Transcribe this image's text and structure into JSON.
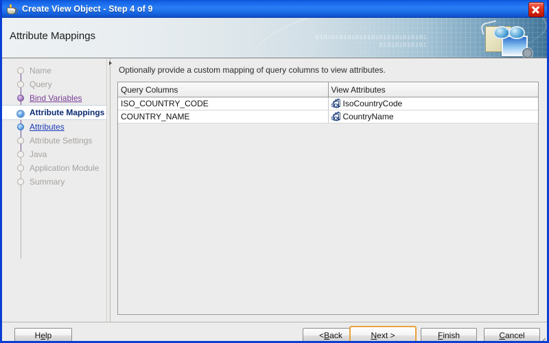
{
  "window": {
    "title": "Create View Object - Step 4 of 9",
    "app_icon": "java-coffee-cup-icon",
    "close_label": "✕",
    "accent_color": "#1565e8",
    "border_color": "#0a3fd4"
  },
  "header": {
    "title": "Attribute Mappings",
    "binary_line1": "0101010101010101010101010101",
    "binary_line2": "010101010101",
    "art": "spectacles-and-monitor-graphic"
  },
  "sidebar": {
    "steps": [
      {
        "label": "Name",
        "state": "pending"
      },
      {
        "label": "Query",
        "state": "pending"
      },
      {
        "label": "Bind Variables",
        "state": "visited"
      },
      {
        "label": "Attribute Mappings",
        "state": "current"
      },
      {
        "label": "Attributes",
        "state": "linked"
      },
      {
        "label": "Attribute Settings",
        "state": "pending"
      },
      {
        "label": "Java",
        "state": "pending"
      },
      {
        "label": "Application Module",
        "state": "pending"
      },
      {
        "label": "Summary",
        "state": "pending"
      }
    ]
  },
  "splitter": {
    "collapse_icon": "collapse-left-arrow-icon"
  },
  "content": {
    "intro": "Optionally provide a custom mapping of query columns to view attributes.",
    "table": {
      "columns": [
        "Query Columns",
        "View Attributes"
      ],
      "rows": [
        {
          "query_column": "ISO_COUNTRY_CODE",
          "view_attribute": "IsoCountryCode",
          "icon": "sql-attribute-icon"
        },
        {
          "query_column": "COUNTRY_NAME",
          "view_attribute": "CountryName",
          "icon": "sql-attribute-icon"
        }
      ]
    }
  },
  "footer": {
    "help": {
      "pre": "H",
      "mnemonic": "e",
      "post": "lp"
    },
    "back": {
      "pre": "< ",
      "mnemonic": "B",
      "post": "ack"
    },
    "next": {
      "pre": "",
      "mnemonic": "N",
      "post": "ext >"
    },
    "finish": {
      "pre": "",
      "mnemonic": "F",
      "post": "inish"
    },
    "cancel": {
      "pre": "",
      "mnemonic": "C",
      "post": "ancel"
    },
    "default_button": "next",
    "default_highlight_color": "#e8a33d",
    "resize_grip": "resize-grip-icon"
  }
}
